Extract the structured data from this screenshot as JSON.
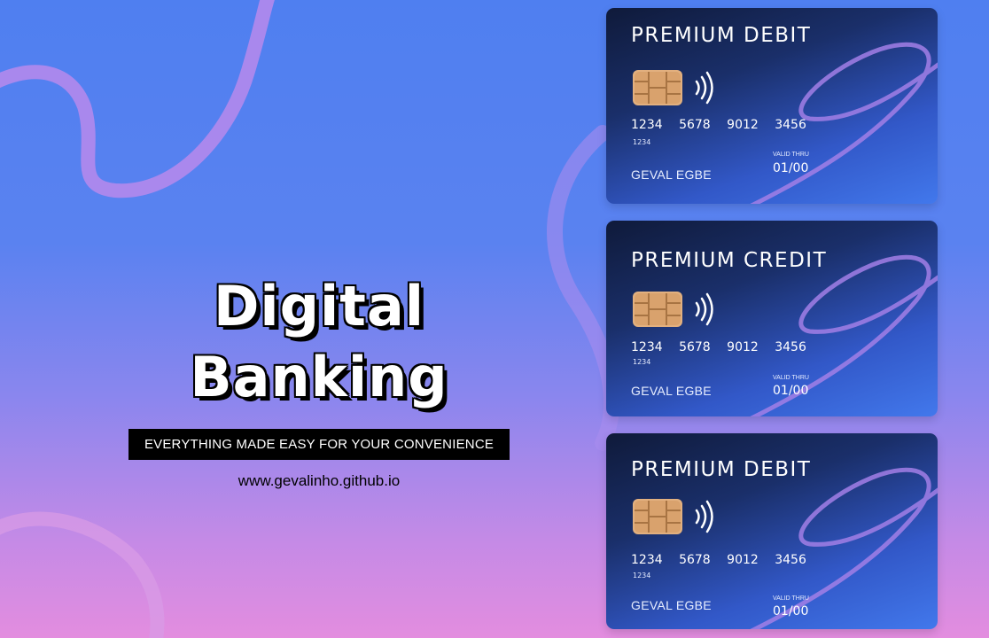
{
  "hero": {
    "title": "Digital Banking",
    "tagline": "EVERYTHING MADE EASY FOR YOUR CONVENIENCE",
    "website": "www.gevalinho.github.io"
  },
  "cards": [
    {
      "type": "PREMIUM DEBIT",
      "number": "1234 5678 9012 3456",
      "number_small": "1234",
      "holder": "GEVAL EGBE",
      "valid_label": "VALID THRU",
      "expiry": "01/00"
    },
    {
      "type": "PREMIUM CREDIT",
      "number": "1234 5678 9012 3456",
      "number_small": "1234",
      "holder": "GEVAL EGBE",
      "valid_label": "VALID THRU",
      "expiry": "01/00"
    },
    {
      "type": "PREMIUM DEBIT",
      "number": "1234 5678 9012 3456",
      "number_small": "1234",
      "holder": "GEVAL EGBE",
      "valid_label": "VALID THRU",
      "expiry": "01/00"
    }
  ],
  "icons": {
    "chip": "chip-icon",
    "contactless": "contactless-icon"
  },
  "colors": {
    "background_top": "#4f7ff0",
    "background_bottom": "#e38ddf",
    "card_dark": "#0f1a3a",
    "card_light": "#4278ec",
    "chip": "#e2b07f",
    "swirl": "#c98ae8"
  }
}
